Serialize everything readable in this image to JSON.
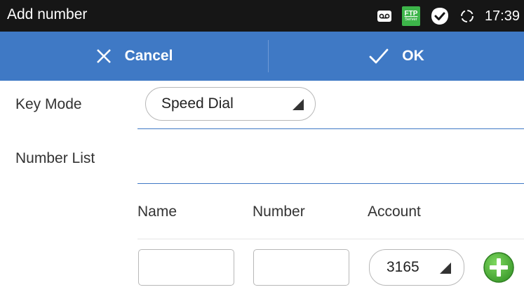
{
  "status_bar": {
    "title": "Add number",
    "icons": [
      "voicemail-icon",
      "ftp-server-icon",
      "check-badge-icon",
      "sync-icon"
    ],
    "ftp_label": "FTP",
    "ftp_sublabel": "Server",
    "time": "17:39"
  },
  "action_bar": {
    "cancel_label": "Cancel",
    "ok_label": "OK",
    "background": "#3f79c5"
  },
  "form": {
    "key_mode_label": "Key Mode",
    "key_mode_value": "Speed Dial",
    "number_list_label": "Number List",
    "columns": {
      "name": "Name",
      "number": "Number",
      "account": "Account"
    },
    "entry": {
      "name_value": "",
      "number_value": "",
      "account_value": "3165"
    }
  },
  "colors": {
    "accent": "#3f79c5",
    "status_bar": "#161616",
    "add_button": "#4caf3a"
  }
}
